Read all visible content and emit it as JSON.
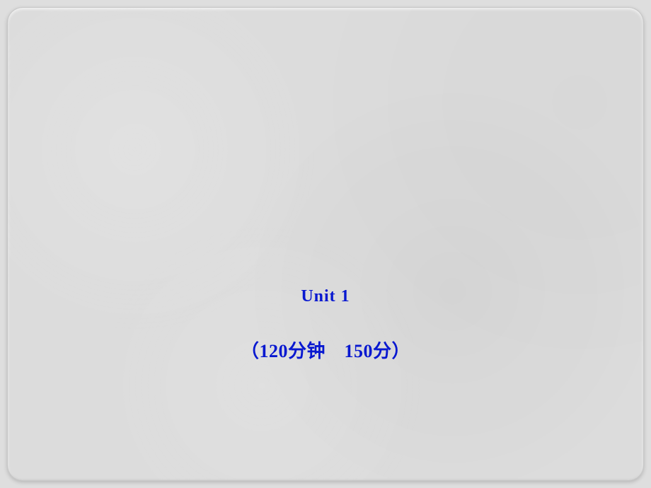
{
  "slide": {
    "unit_label": "Unit",
    "unit_number": "1",
    "paren_open": "（",
    "duration_value": "120",
    "duration_unit": "分钟",
    "spacer": "　",
    "score_value": "150",
    "score_unit": "分",
    "paren_close": "）"
  }
}
